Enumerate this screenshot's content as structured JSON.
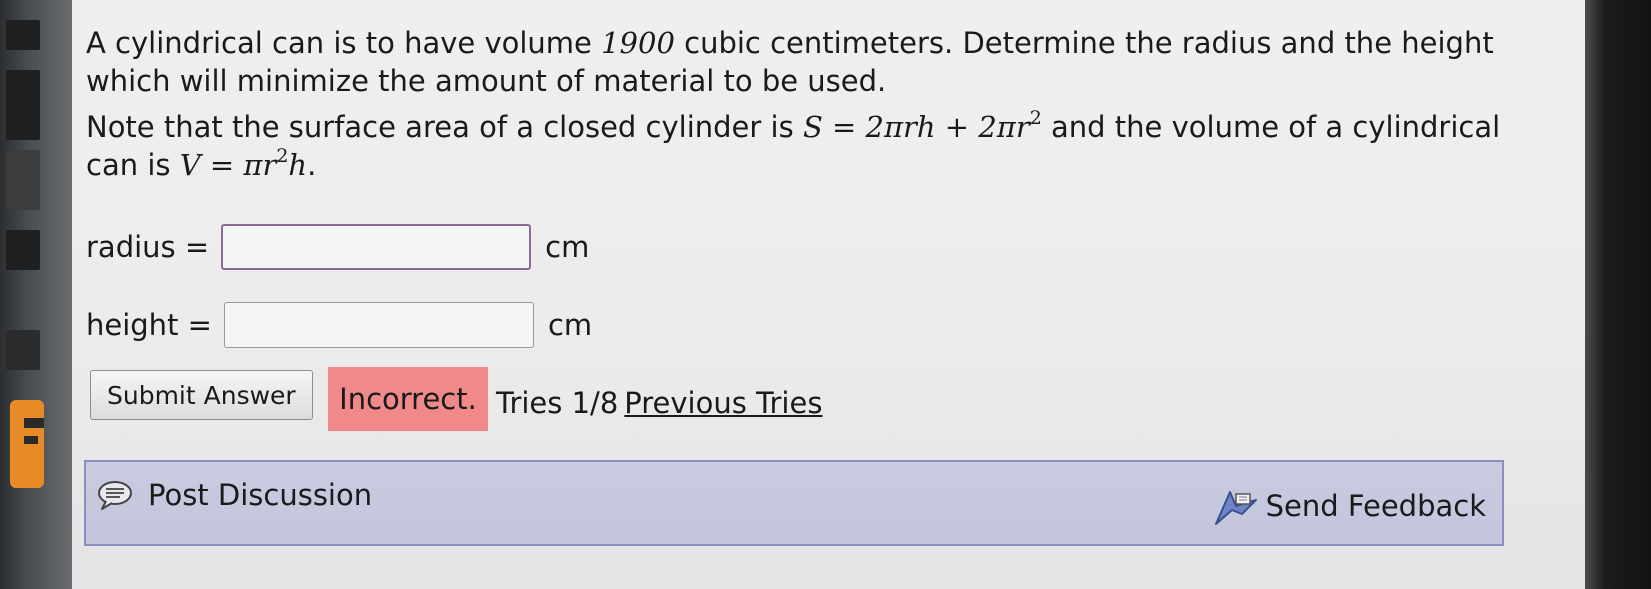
{
  "question": {
    "line1": "A cylindrical can is to have volume ",
    "volume": "1900",
    "line1b": " cubic centimeters. Determine the radius and the height which will minimize the amount of material to be used.",
    "note_pre": "Note that the surface area of a closed cylinder is ",
    "surface_formula_a": "S = 2πrh + 2πr",
    "surface_formula_exp": "2",
    "note_mid": " and the volume of a cylindrical can is ",
    "volume_formula_a": "V = πr",
    "volume_formula_exp": "2",
    "volume_formula_b": "h",
    "note_end": "."
  },
  "fields": {
    "radius_label": "radius =",
    "radius_value": "",
    "radius_unit": "cm",
    "height_label": "height =",
    "height_value": "",
    "height_unit": "cm"
  },
  "actions": {
    "submit_label": "Submit Answer",
    "status": "Incorrect.",
    "tries_text": "Tries 1/8",
    "previous_tries_label": "Previous Tries"
  },
  "footer": {
    "post_discussion_label": "Post Discussion",
    "send_feedback_label": "Send Feedback"
  },
  "colors": {
    "incorrect_bg": "#f08a8a",
    "discussion_bg": "#c6c8de",
    "discussion_border": "#8b8fc0",
    "focused_input_border": "#8a6a95"
  },
  "icons": {
    "post_discussion": "speech-bubble-icon",
    "send_feedback": "feedback-arrow-icon"
  }
}
